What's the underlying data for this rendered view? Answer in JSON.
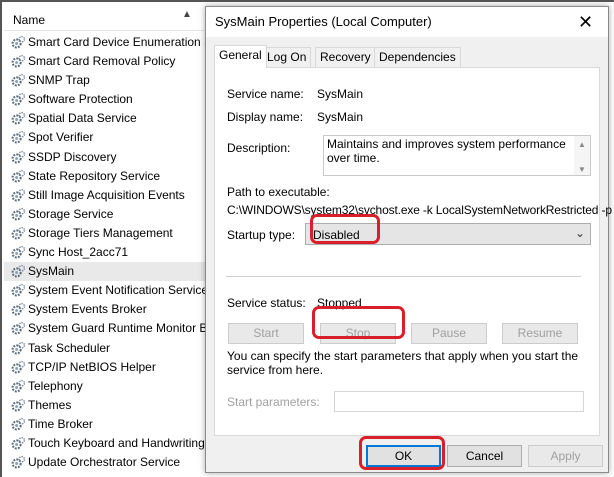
{
  "list": {
    "column_header": "Name",
    "services": [
      "Smart Card Device Enumeration S",
      "Smart Card Removal Policy",
      "SNMP Trap",
      "Software Protection",
      "Spatial Data Service",
      "Spot Verifier",
      "SSDP Discovery",
      "State Repository Service",
      "Still Image Acquisition Events",
      "Storage Service",
      "Storage Tiers Management",
      "Sync Host_2acc71",
      "SysMain",
      "System Event Notification Service",
      "System Events Broker",
      "System Guard Runtime Monitor B",
      "Task Scheduler",
      "TCP/IP NetBIOS Helper",
      "Telephony",
      "Themes",
      "Time Broker",
      "Touch Keyboard and Handwriting",
      "Update Orchestrator Service"
    ],
    "selected": "SysMain"
  },
  "dialog": {
    "title": "SysMain Properties (Local Computer)",
    "close_glyph": "✕",
    "tabs": [
      "General",
      "Log On",
      "Recovery",
      "Dependencies"
    ],
    "service_name_label": "Service name:",
    "service_name": "SysMain",
    "display_name_label": "Display name:",
    "display_name": "SysMain",
    "description_label": "Description:",
    "description": "Maintains and improves system performance over time.",
    "path_label": "Path to executable:",
    "path": "C:\\WINDOWS\\system32\\svchost.exe -k LocalSystemNetworkRestricted -p",
    "startup_type_label": "Startup type:",
    "startup_type": "Disabled",
    "service_status_label": "Service status:",
    "service_status": "Stopped",
    "buttons": {
      "start": "Start",
      "stop": "Stop",
      "pause": "Pause",
      "resume": "Resume"
    },
    "hint": "You can specify the start parameters that apply when you start the service from here.",
    "start_params_label": "Start parameters:",
    "ok": "OK",
    "cancel": "Cancel",
    "apply": "Apply"
  },
  "colors": {
    "highlight": "#d81f2a",
    "ok_focus": "#0078d7"
  }
}
